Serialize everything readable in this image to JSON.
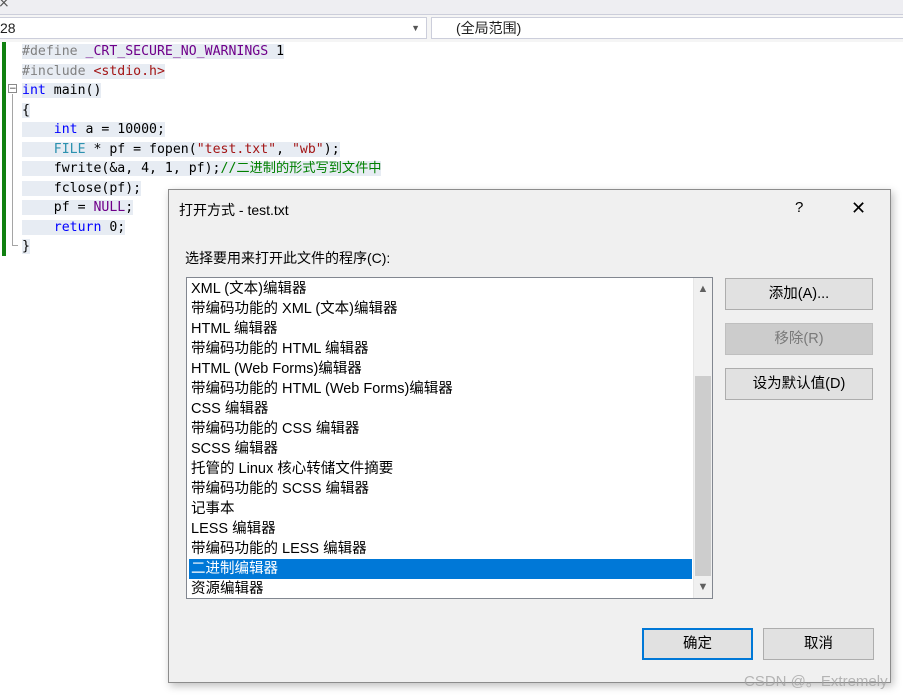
{
  "top": {
    "tab_close": "×"
  },
  "combos": {
    "left_value": "28",
    "right_value": "(全局范围)"
  },
  "code": {
    "lines": [
      {
        "parts": [
          {
            "c": "pp",
            "t": "#define "
          },
          {
            "c": "mac",
            "t": "_CRT_SECURE_NO_WARNINGS"
          },
          {
            "c": "",
            "t": " 1"
          }
        ]
      },
      {
        "parts": [
          {
            "c": "pp",
            "t": "#include "
          },
          {
            "c": "str",
            "t": "<stdio.h>"
          }
        ]
      },
      {
        "parts": [
          {
            "c": "kw",
            "t": "int"
          },
          {
            "c": "",
            "t": " main()"
          }
        ]
      },
      {
        "parts": [
          {
            "c": "",
            "t": "{"
          }
        ]
      },
      {
        "parts": [
          {
            "c": "",
            "t": "    "
          },
          {
            "c": "kw",
            "t": "int"
          },
          {
            "c": "",
            "t": " a = 10000;"
          }
        ]
      },
      {
        "parts": [
          {
            "c": "",
            "t": "    "
          },
          {
            "c": "ty",
            "t": "FILE"
          },
          {
            "c": "",
            "t": " * pf = fopen("
          },
          {
            "c": "str",
            "t": "\"test.txt\""
          },
          {
            "c": "",
            "t": ", "
          },
          {
            "c": "str",
            "t": "\"wb\""
          },
          {
            "c": "",
            "t": ");"
          }
        ]
      },
      {
        "parts": [
          {
            "c": "",
            "t": "    fwrite(&a, 4, 1, pf);"
          },
          {
            "c": "cm",
            "t": "//二进制的形式写到文件中"
          }
        ]
      },
      {
        "parts": [
          {
            "c": "",
            "t": "    fclose(pf);"
          }
        ]
      },
      {
        "parts": [
          {
            "c": "",
            "t": "    pf = "
          },
          {
            "c": "mac",
            "t": "NULL"
          },
          {
            "c": "",
            "t": ";"
          }
        ]
      },
      {
        "parts": [
          {
            "c": "",
            "t": "    "
          },
          {
            "c": "kw",
            "t": "return"
          },
          {
            "c": "",
            "t": " 0;"
          }
        ]
      },
      {
        "parts": [
          {
            "c": "",
            "t": "}"
          }
        ]
      }
    ]
  },
  "dialog": {
    "title": "打开方式 - test.txt",
    "help": "?",
    "close": "✕",
    "label": "选择要用来打开此文件的程序(C):",
    "programs": [
      "XML (文本)编辑器",
      "带编码功能的 XML (文本)编辑器",
      "HTML 编辑器",
      "带编码功能的 HTML 编辑器",
      "HTML (Web Forms)编辑器",
      "带编码功能的 HTML (Web Forms)编辑器",
      "CSS 编辑器",
      "带编码功能的 CSS 编辑器",
      "SCSS 编辑器",
      "托管的 Linux 核心转储文件摘要",
      "带编码功能的 SCSS 编辑器",
      "记事本",
      "LESS 编辑器",
      "带编码功能的 LESS 编辑器",
      "二进制编辑器",
      "资源编辑器"
    ],
    "selected_index": 14,
    "scroll_up": "▲",
    "scroll_down": "▼",
    "buttons": {
      "add": "添加(A)...",
      "remove": "移除(R)",
      "set_default": "设为默认值(D)",
      "ok": "确定",
      "cancel": "取消"
    }
  },
  "watermark": "CSDN @。Extremely"
}
